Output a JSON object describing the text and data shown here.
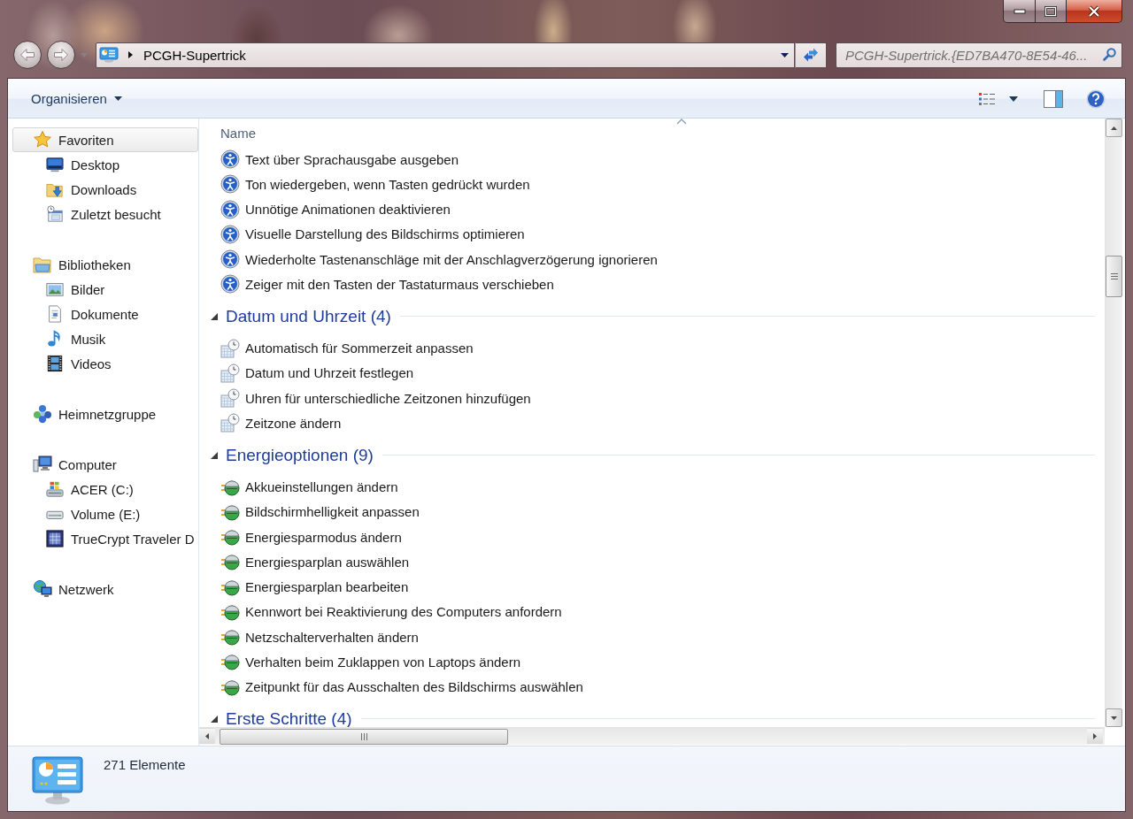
{
  "navigation": {
    "back": {
      "disabled": true
    },
    "forward": {
      "disabled": true
    },
    "path": [
      "PCGH-Supertrick"
    ]
  },
  "search": {
    "placeholder": "PCGH-Supertrick.{ED7BA470-8E54-46..."
  },
  "toolbar": {
    "organize": "Organisieren"
  },
  "sidebar": {
    "items": [
      {
        "label": "Favoriten",
        "kind": "favorites",
        "selected": true,
        "children": [
          {
            "label": "Desktop",
            "kind": "desktop",
            "selected": false
          },
          {
            "label": "Downloads",
            "kind": "downloads",
            "selected": false
          },
          {
            "label": "Zuletzt besucht",
            "kind": "recent",
            "selected": false
          }
        ]
      },
      {
        "label": "Bibliotheken",
        "kind": "libraries",
        "selected": false,
        "children": [
          {
            "label": "Bilder",
            "kind": "pictures",
            "selected": false
          },
          {
            "label": "Dokumente",
            "kind": "documents",
            "selected": false
          },
          {
            "label": "Musik",
            "kind": "music",
            "selected": false
          },
          {
            "label": "Videos",
            "kind": "videos",
            "selected": false
          }
        ]
      },
      {
        "label": "Heimnetzgruppe",
        "kind": "homegroup",
        "selected": false
      },
      {
        "label": "Computer",
        "kind": "computer",
        "selected": false,
        "children": [
          {
            "label": "ACER (C:)",
            "kind": "systemdrive",
            "selected": false
          },
          {
            "label": "Volume (E:)",
            "kind": "drive",
            "selected": false
          },
          {
            "label": "TrueCrypt Traveler D",
            "kind": "mounted",
            "selected": false
          }
        ]
      },
      {
        "label": "Netzwerk",
        "kind": "network",
        "selected": false
      }
    ]
  },
  "list": {
    "column": {
      "label": "Name",
      "sort_ascending": true
    },
    "groups": [
      {
        "kind": "accessibility",
        "items": [
          {
            "label": "Text über Sprachausgabe ausgeben",
            "selected": false
          },
          {
            "label": "Ton wiedergeben, wenn Tasten gedrückt wurden",
            "selected": false
          },
          {
            "label": "Unnötige Animationen deaktivieren",
            "selected": false
          },
          {
            "label": "Visuelle Darstellung des Bildschirms optimieren",
            "selected": false
          },
          {
            "label": "Wiederholte Tastenanschläge mit der Anschlagverzögerung ignorieren",
            "selected": false
          },
          {
            "label": "Zeiger mit den Tasten der Tastaturmaus verschieben",
            "selected": false
          }
        ]
      },
      {
        "heading": "Datum und Uhrzeit (4)",
        "expanded": true,
        "kind": "datetime",
        "items": [
          {
            "label": "Automatisch für Sommerzeit anpassen",
            "selected": false
          },
          {
            "label": "Datum und Uhrzeit festlegen",
            "selected": false
          },
          {
            "label": "Uhren für unterschiedliche Zeitzonen hinzufügen",
            "selected": false
          },
          {
            "label": "Zeitzone ändern",
            "selected": false
          }
        ]
      },
      {
        "heading": "Energieoptionen (9)",
        "expanded": true,
        "kind": "power",
        "items": [
          {
            "label": "Akkueinstellungen ändern",
            "selected": false
          },
          {
            "label": "Bildschirmhelligkeit anpassen",
            "selected": false
          },
          {
            "label": "Energiesparmodus ändern",
            "selected": false
          },
          {
            "label": "Energiesparplan auswählen",
            "selected": false
          },
          {
            "label": "Energiesparplan bearbeiten",
            "selected": false
          },
          {
            "label": "Kennwort bei Reaktivierung des Computers anfordern",
            "selected": false
          },
          {
            "label": "Netzschalterverhalten ändern",
            "selected": false
          },
          {
            "label": "Verhalten beim Zuklappen von Laptops ändern",
            "selected": false
          },
          {
            "label": "Zeitpunkt für das Ausschalten des Bildschirms auswählen",
            "selected": false
          }
        ]
      },
      {
        "heading": "Erste Schritte (4)",
        "expanded": true
      }
    ]
  },
  "status_bar": {
    "count": "271 Elemente"
  }
}
